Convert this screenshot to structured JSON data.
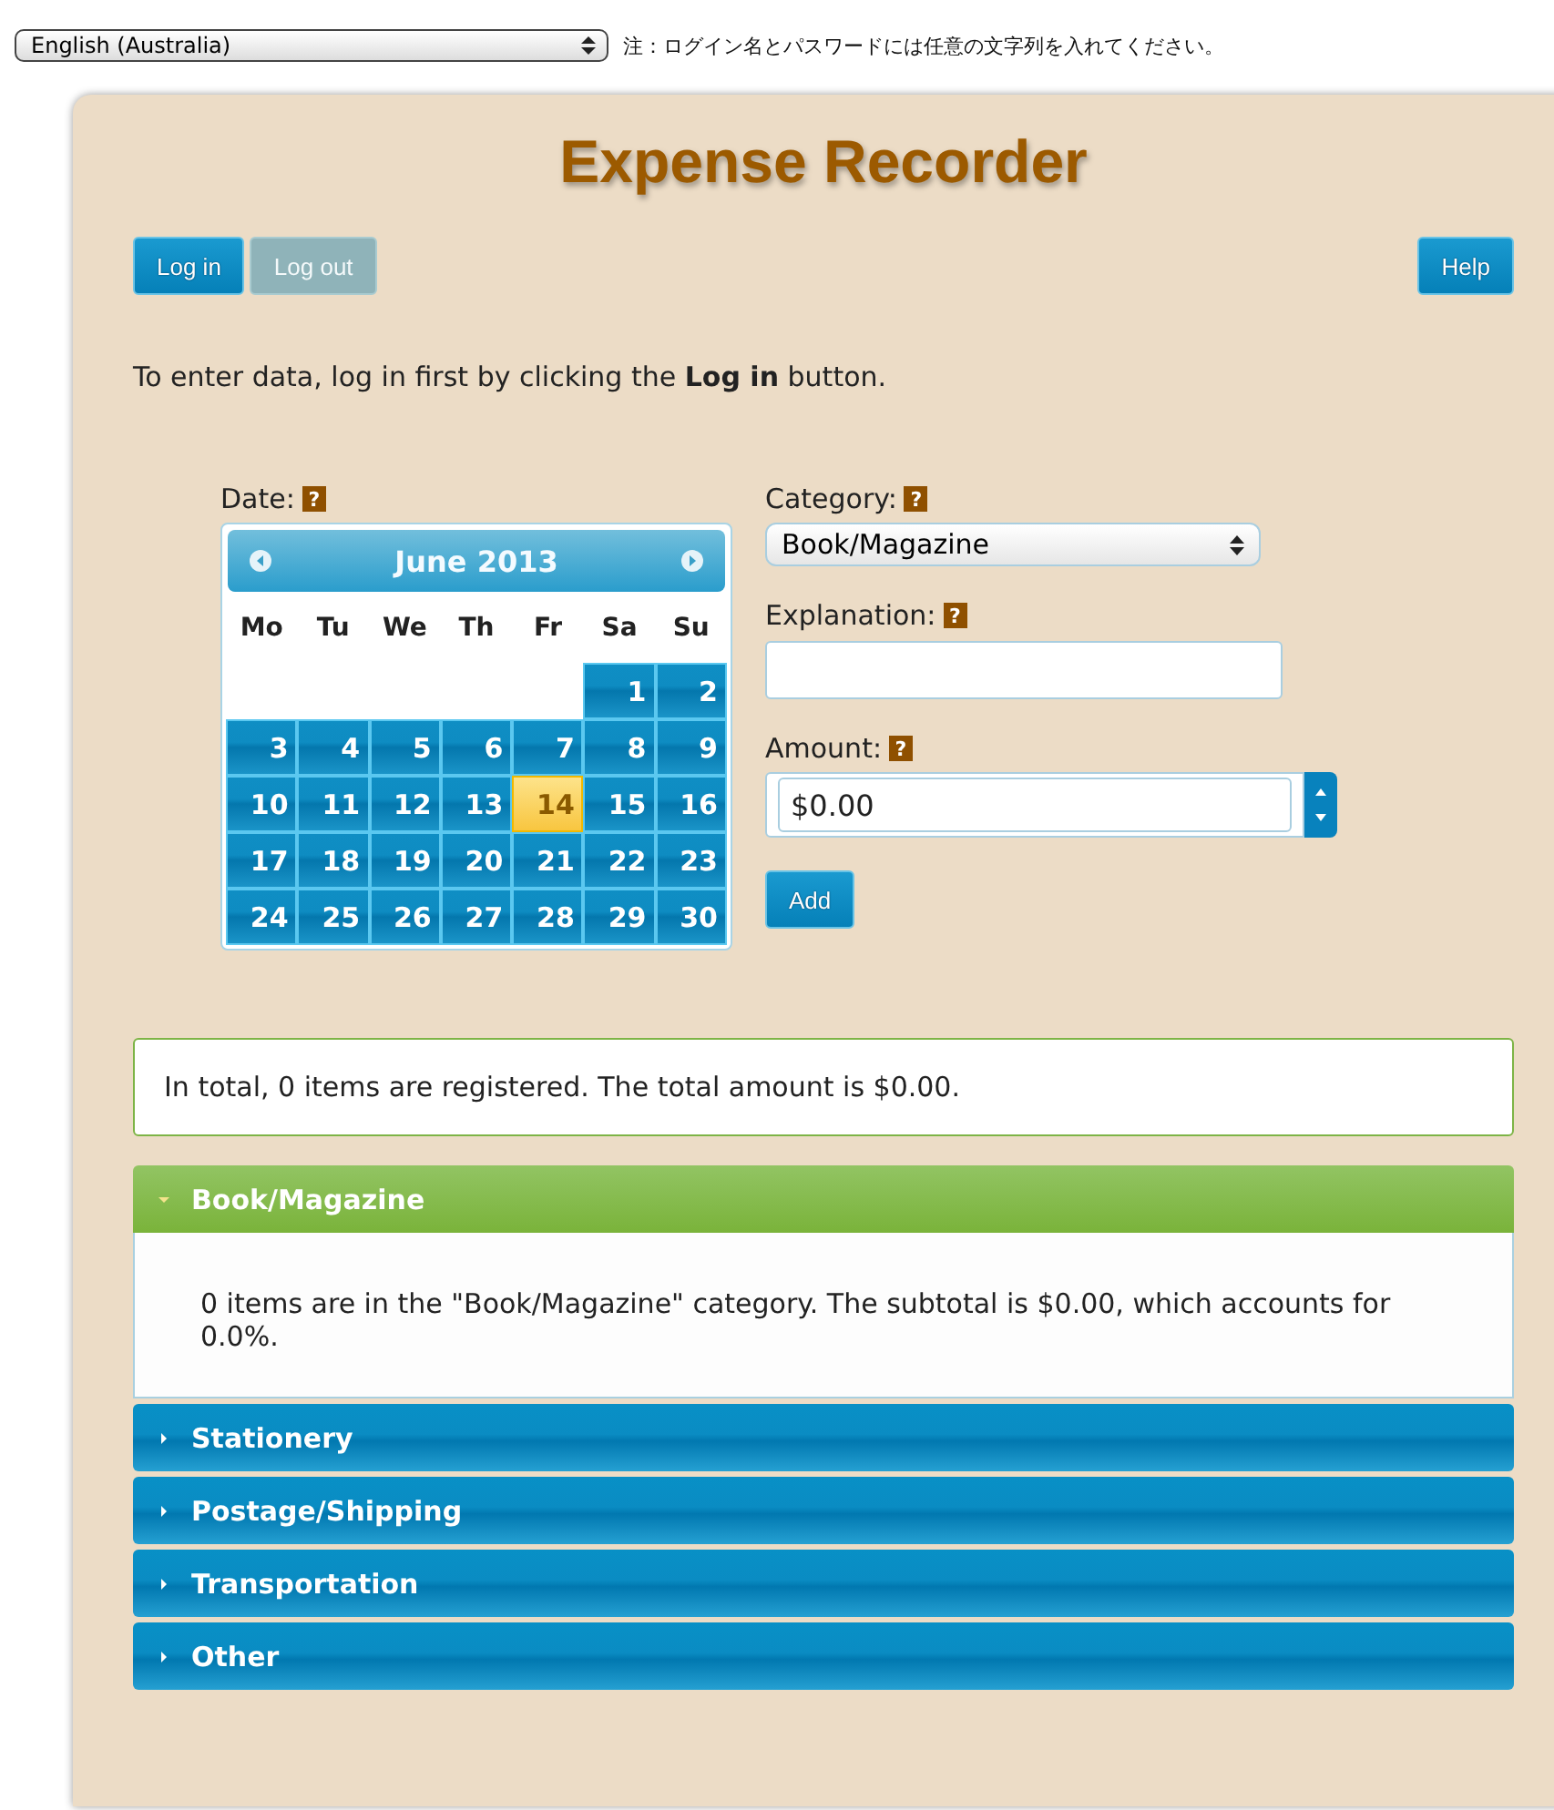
{
  "language_select": {
    "value": "English (Australia)"
  },
  "note": "注：ログイン名とパスワードには任意の文字列を入れてください。",
  "title": "Expense Recorder",
  "buttons": [
    {
      "label": "Log in",
      "disabled": false
    },
    {
      "label": "Log out",
      "disabled": true
    }
  ],
  "help_button": "Help",
  "instruction": "To enter data, log in first by clicking the **Log in** button.",
  "date": {
    "label": "Date:",
    "help": "?",
    "calendar": {
      "month": "June 2013",
      "weekdays": [
        "Mo",
        "Tu",
        "We",
        "Th",
        "Fr",
        "Sa",
        "Su"
      ],
      "weeks": [
        [
          {
            "kind": "blank"
          },
          {
            "kind": "blank"
          },
          {
            "kind": "blank"
          },
          {
            "kind": "blank"
          },
          {
            "kind": "blank"
          },
          {
            "kind": "day",
            "day": "1",
            "selected": false
          },
          {
            "kind": "day",
            "day": "2",
            "selected": false
          }
        ],
        [
          {
            "kind": "day",
            "day": "3",
            "selected": false
          },
          {
            "kind": "day",
            "day": "4",
            "selected": false
          },
          {
            "kind": "day",
            "day": "5",
            "selected": false
          },
          {
            "kind": "day",
            "day": "6",
            "selected": false
          },
          {
            "kind": "day",
            "day": "7",
            "selected": false
          },
          {
            "kind": "day",
            "day": "8",
            "selected": false
          },
          {
            "kind": "day",
            "day": "9",
            "selected": false
          }
        ],
        [
          {
            "kind": "day",
            "day": "10",
            "selected": false
          },
          {
            "kind": "day",
            "day": "11",
            "selected": false
          },
          {
            "kind": "day",
            "day": "12",
            "selected": false
          },
          {
            "kind": "day",
            "day": "13",
            "selected": false
          },
          {
            "kind": "day",
            "day": "14",
            "selected": true
          },
          {
            "kind": "day",
            "day": "15",
            "selected": false
          },
          {
            "kind": "day",
            "day": "16",
            "selected": false
          }
        ],
        [
          {
            "kind": "day",
            "day": "17",
            "selected": false
          },
          {
            "kind": "day",
            "day": "18",
            "selected": false
          },
          {
            "kind": "day",
            "day": "19",
            "selected": false
          },
          {
            "kind": "day",
            "day": "20",
            "selected": false
          },
          {
            "kind": "day",
            "day": "21",
            "selected": false
          },
          {
            "kind": "day",
            "day": "22",
            "selected": false
          },
          {
            "kind": "day",
            "day": "23",
            "selected": false
          }
        ],
        [
          {
            "kind": "day",
            "day": "24",
            "selected": false
          },
          {
            "kind": "day",
            "day": "25",
            "selected": false
          },
          {
            "kind": "day",
            "day": "26",
            "selected": false
          },
          {
            "kind": "day",
            "day": "27",
            "selected": false
          },
          {
            "kind": "day",
            "day": "28",
            "selected": false
          },
          {
            "kind": "day",
            "day": "29",
            "selected": false
          },
          {
            "kind": "day",
            "day": "30",
            "selected": false
          }
        ]
      ]
    }
  },
  "category": {
    "label": "Category:",
    "help": "?",
    "value": "Book/Magazine"
  },
  "explanation": {
    "label": "Explanation:",
    "help": "?"
  },
  "amount": {
    "label": "Amount:",
    "help": "?",
    "value": "$0.00"
  },
  "add_button": "Add",
  "summary": "In total, 0 items are registered. The total amount is $0.00.",
  "sections": [
    {
      "title": "Book/Magazine",
      "expanded": true,
      "content": "0 items are in the \"Book/Magazine\" category. The subtotal is $0.00, which accounts for 0.0%."
    },
    {
      "title": "Stationery",
      "expanded": false
    },
    {
      "title": "Postage/Shipping",
      "expanded": false
    },
    {
      "title": "Transportation",
      "expanded": false
    },
    {
      "title": "Other",
      "expanded": false
    }
  ]
}
